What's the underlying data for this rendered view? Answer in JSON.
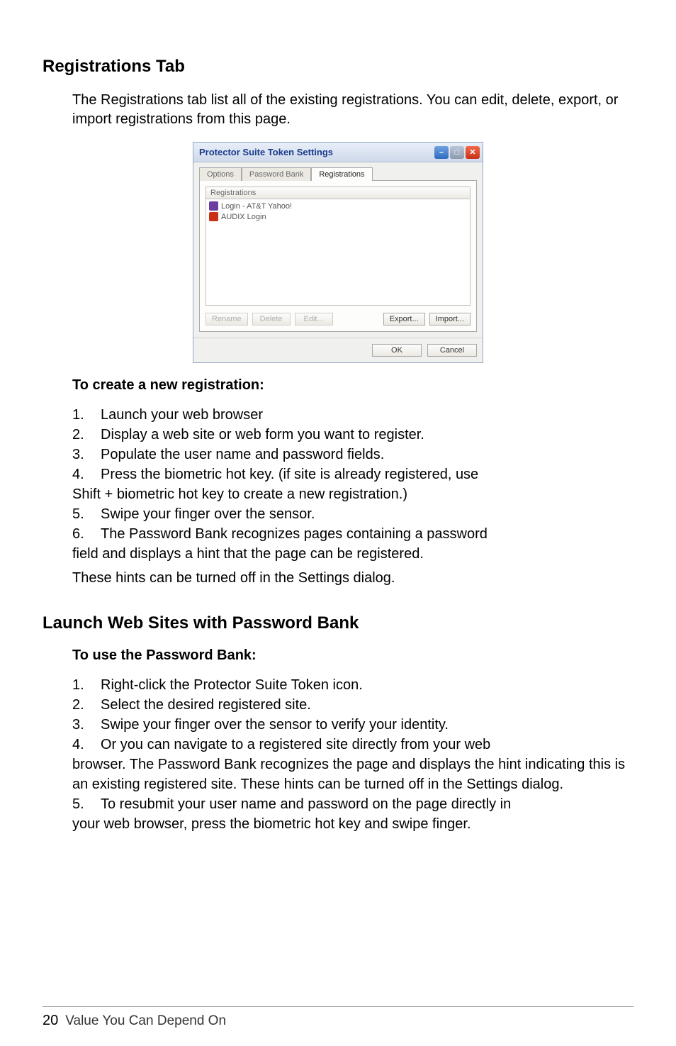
{
  "section1": {
    "title": "Registrations Tab",
    "intro": "The Registrations tab list all of the existing registrations. You can edit, delete, export, or import registrations from this page."
  },
  "window": {
    "title": "Protector Suite Token Settings",
    "tabs": {
      "t1": "Options",
      "t2": "Password Bank",
      "t3": "Registrations"
    },
    "list_header": "Registrations",
    "items": {
      "i1": "Login - AT&T Yahoo!",
      "i2": "AUDIX Login"
    },
    "buttons": {
      "rename": "Rename",
      "delete": "Delete",
      "edit": "Edit...",
      "export": "Export...",
      "import": "Import...",
      "ok": "OK",
      "cancel": "Cancel"
    }
  },
  "howto1": {
    "title": "To create a new registration:",
    "s1": "Launch your web browser",
    "s2": "Display a web site or web form you want to register.",
    "s3": "Populate the user name and password fields.",
    "s4a": "Press the biometric hot key. (if site is already registered, use",
    "s4b": "Shift + biometric hot key to create a new registration.)",
    "s5": "Swipe your finger over the sensor.",
    "s6a": "The Password Bank recognizes pages containing a password",
    "s6b": "field and displays a hint that the page can be registered.",
    "note": "These hints can be turned off in the Settings dialog."
  },
  "section2": {
    "title": "Launch Web Sites with Password Bank"
  },
  "howto2": {
    "title": "To use the Password Bank:",
    "s1": "Right-click the Protector Suite Token icon.",
    "s2": "Select the desired registered site.",
    "s3": "Swipe your finger over the sensor to verify your identity.",
    "s4a": "Or you can navigate to a registered site directly from your web",
    "s4b": "browser. The Password Bank recognizes the page and displays the hint indicating this is an existing registered site. These hints can be turned off in the Settings dialog.",
    "s5a": "To resubmit your user name and password on the page directly in",
    "s5b": "your web browser, press the biometric hot key and swipe finger."
  },
  "footer": {
    "page": "20",
    "text": "Value You Can Depend On"
  }
}
